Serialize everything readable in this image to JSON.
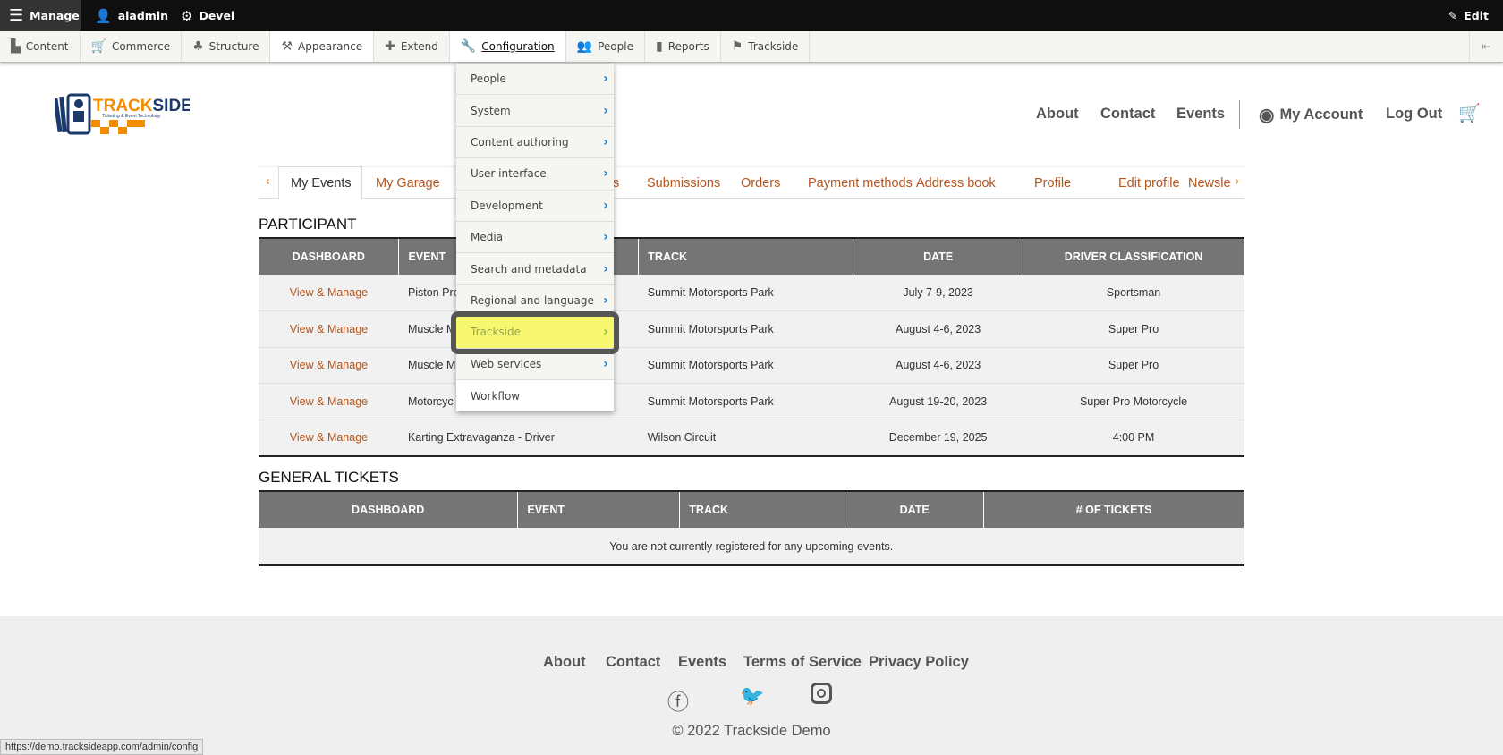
{
  "toolbar": {
    "manage": "Manage",
    "user": "aiadmin",
    "devel": "Devel",
    "edit": "Edit"
  },
  "tray": [
    {
      "label": "Content",
      "icon": "file-icon"
    },
    {
      "label": "Commerce",
      "icon": "cart-icon"
    },
    {
      "label": "Structure",
      "icon": "sitemap-icon"
    },
    {
      "label": "Appearance",
      "icon": "brush-icon"
    },
    {
      "label": "Extend",
      "icon": "puzzle-icon"
    },
    {
      "label": "Configuration",
      "icon": "wrench-icon"
    },
    {
      "label": "People",
      "icon": "people-icon"
    },
    {
      "label": "Reports",
      "icon": "bar-chart-icon"
    },
    {
      "label": "Trackside",
      "icon": "flag-icon"
    }
  ],
  "config_menu": [
    "People",
    "System",
    "Content authoring",
    "User interface",
    "Development",
    "Media",
    "Search and metadata",
    "Regional and language",
    "Trackside",
    "Web services",
    "Workflow"
  ],
  "logo": {
    "text": "TRACKSIDE",
    "tagline": "Ticketing & Event Technology",
    "brand_color": "#f28c00",
    "navy": "#1b3a6b"
  },
  "nav": {
    "about": "About",
    "contact": "Contact",
    "events": "Events",
    "account": "My Account",
    "logout": "Log Out"
  },
  "tabs": [
    "My Events",
    "My Garage",
    "s",
    "Submissions",
    "Orders",
    "Payment methods",
    "Address book",
    "Profile",
    "Edit profile",
    "Newsle"
  ],
  "participant": {
    "title": "PARTICIPANT",
    "headers": [
      "Dashboard",
      "Event",
      "Track",
      "Date",
      "Driver Classification"
    ],
    "rows": [
      [
        "View & Manage",
        "Piston Pro",
        "Summit Motorsports Park",
        "July 7-9, 2023",
        "Sportsman"
      ],
      [
        "View & Manage",
        "Muscle M",
        "Summit Motorsports Park",
        "August 4-6, 2023",
        "Super Pro"
      ],
      [
        "View & Manage",
        "Muscle M",
        "Summit Motorsports Park",
        "August 4-6, 2023",
        "Super Pro"
      ],
      [
        "View & Manage",
        "Motorcyc",
        "Summit Motorsports Park",
        "August 19-20, 2023",
        "Super Pro Motorcycle"
      ],
      [
        "View & Manage",
        "Karting Extravaganza - Driver",
        "Wilson Circuit",
        "December 19, 2025",
        "4:00 PM"
      ]
    ]
  },
  "general": {
    "title": "GENERAL TICKETS",
    "headers": [
      "Dashboard",
      "Event",
      "Track",
      "Date",
      "# of Tickets"
    ],
    "empty": "You are not currently registered for any upcoming events."
  },
  "footer": {
    "links": [
      "About",
      "Contact",
      "Events",
      "Terms of Service",
      "Privacy Policy"
    ],
    "copyright": "© 2022 Trackside Demo"
  },
  "status_url": "https://demo.tracksideapp.com/admin/config",
  "colors": {
    "accent": "#b5541b",
    "highlight": "#f8f870",
    "header_bg": "#757575"
  }
}
